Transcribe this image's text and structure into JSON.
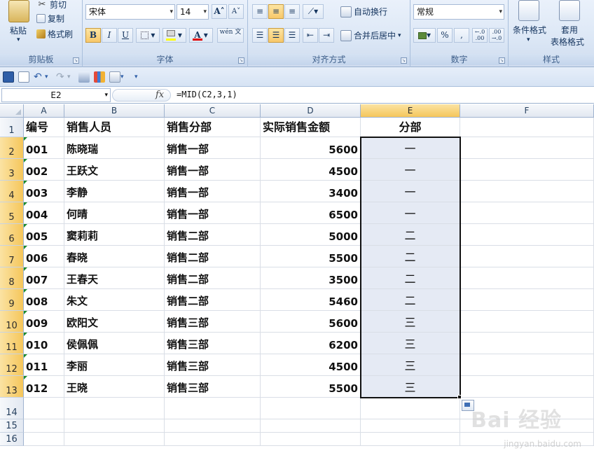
{
  "ribbon": {
    "clipboard": {
      "paste_label": "粘贴",
      "cut_label": "剪切",
      "copy_label": "复制",
      "format_painter_label": "格式刷",
      "title": "剪贴板"
    },
    "font": {
      "font_name": "宋体",
      "font_size": "14",
      "grow_label": "A",
      "shrink_label": "A",
      "bold_label": "B",
      "italic_label": "I",
      "underline_label": "U",
      "font_color_label": "A",
      "phonetic_label": "wén 文",
      "title": "字体",
      "fill_color": "#ffff00",
      "font_color": "#e00000"
    },
    "alignment": {
      "wrap_label": "自动换行",
      "merge_label": "合并后居中",
      "title": "对齐方式"
    },
    "number": {
      "format_value": "常规",
      "percent_label": "%",
      "comma_label": ",",
      "title": "数字"
    },
    "styles": {
      "conditional_label": "条件格式",
      "table_format_label1": "套用",
      "table_format_label2": "表格格式",
      "title": "样式"
    }
  },
  "formula_bar": {
    "name_box": "E2",
    "fx_label": "fx",
    "formula": "=MID(C2,3,1)"
  },
  "sheet": {
    "columns": [
      "A",
      "B",
      "C",
      "D",
      "E",
      "F"
    ],
    "rows": [
      "1",
      "2",
      "3",
      "4",
      "5",
      "6",
      "7",
      "8",
      "9",
      "10",
      "11",
      "12",
      "13",
      "14",
      "15",
      "16"
    ],
    "header": [
      "编号",
      "销售人员",
      "销售分部",
      "实际销售金额",
      "分部"
    ],
    "data": [
      [
        "001",
        "陈晓瑞",
        "销售一部",
        "5600",
        "一"
      ],
      [
        "002",
        "王跃文",
        "销售一部",
        "4500",
        "一"
      ],
      [
        "003",
        "李静",
        "销售一部",
        "3400",
        "一"
      ],
      [
        "004",
        "何晴",
        "销售一部",
        "6500",
        "一"
      ],
      [
        "005",
        "窦莉莉",
        "销售二部",
        "5000",
        "二"
      ],
      [
        "006",
        "春晓",
        "销售二部",
        "5500",
        "二"
      ],
      [
        "007",
        "王春天",
        "销售二部",
        "3500",
        "二"
      ],
      [
        "008",
        "朱文",
        "销售二部",
        "5460",
        "二"
      ],
      [
        "009",
        "欧阳文",
        "销售三部",
        "5600",
        "三"
      ],
      [
        "010",
        "侯佩佩",
        "销售三部",
        "6200",
        "三"
      ],
      [
        "011",
        "李丽",
        "销售三部",
        "4500",
        "三"
      ],
      [
        "012",
        "王晓",
        "销售三部",
        "5500",
        "三"
      ]
    ]
  },
  "watermark": {
    "text": "Bai 经验",
    "url": "jingyan.baidu.com"
  }
}
